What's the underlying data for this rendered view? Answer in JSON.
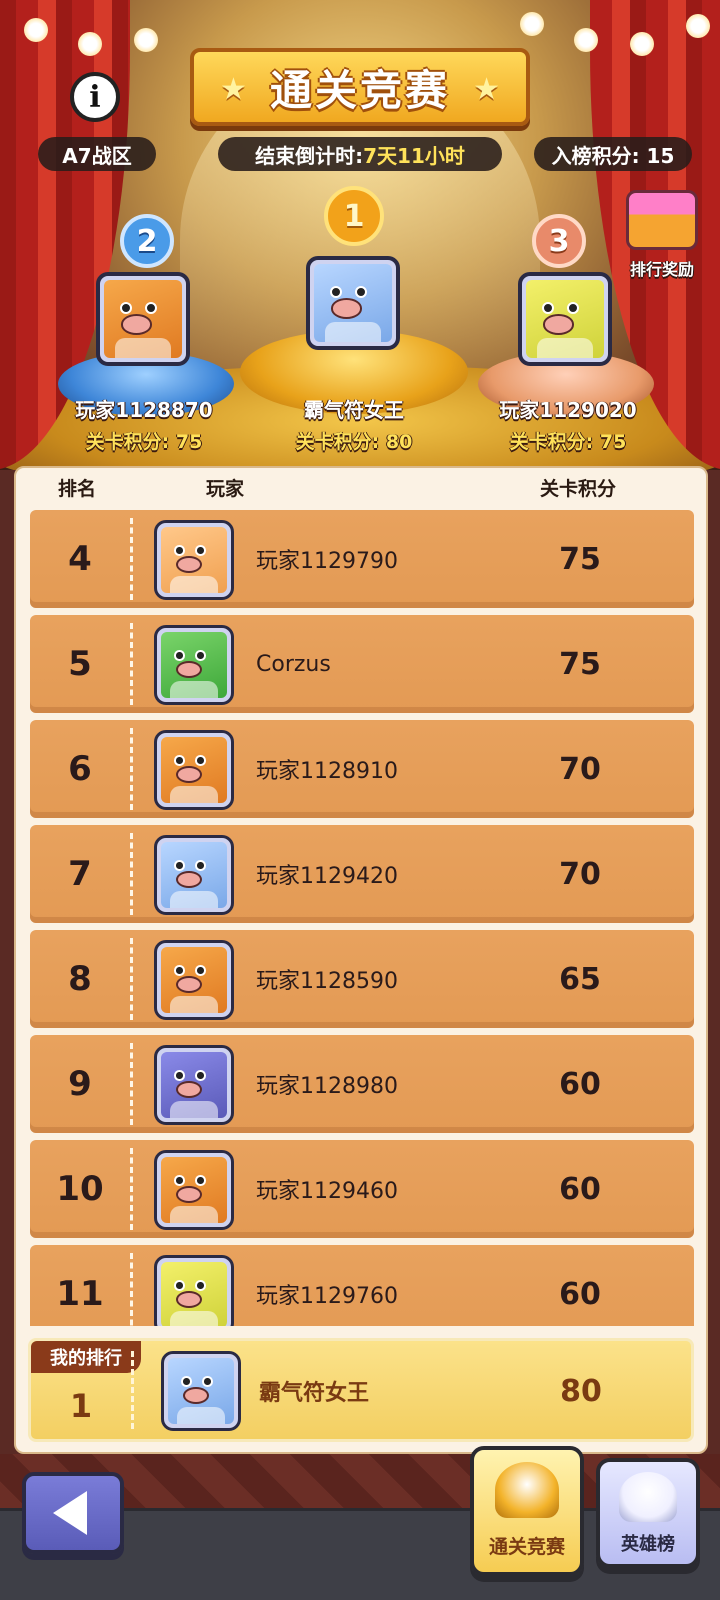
{
  "header": {
    "title": "通关竞赛",
    "zone": "A7战区",
    "countdown_label": "结束倒计时:",
    "countdown_value": "7天11小时",
    "entry_score": "入榜积分: 15",
    "reward_label": "排行奖励"
  },
  "podium": [
    {
      "rank": "1",
      "name": "霸气符女王",
      "score": "关卡积分: 80",
      "avatar": "blue"
    },
    {
      "rank": "2",
      "name": "玩家1128870",
      "score": "关卡积分: 75",
      "avatar": "orange"
    },
    {
      "rank": "3",
      "name": "玩家1129020",
      "score": "关卡积分: 75",
      "avatar": "yellow"
    }
  ],
  "table": {
    "headers": {
      "rank": "排名",
      "player": "玩家",
      "score": "关卡积分"
    },
    "rows": [
      {
        "rank": "4",
        "name": "玩家1129790",
        "score": "75",
        "avatar": "peach"
      },
      {
        "rank": "5",
        "name": "Corzus",
        "score": "75",
        "avatar": "green"
      },
      {
        "rank": "6",
        "name": "玩家1128910",
        "score": "70",
        "avatar": "orange"
      },
      {
        "rank": "7",
        "name": "玩家1129420",
        "score": "70",
        "avatar": "blue"
      },
      {
        "rank": "8",
        "name": "玩家1128590",
        "score": "65",
        "avatar": "orange"
      },
      {
        "rank": "9",
        "name": "玩家1128980",
        "score": "60",
        "avatar": "purple"
      },
      {
        "rank": "10",
        "name": "玩家1129460",
        "score": "60",
        "avatar": "orange"
      },
      {
        "rank": "11",
        "name": "玩家1129760",
        "score": "60",
        "avatar": "yellow"
      }
    ]
  },
  "my_rank": {
    "label": "我的排行",
    "rank": "1",
    "name": "霸气符女王",
    "score": "80",
    "avatar": "blue"
  },
  "tabs": [
    {
      "label": "通关竞赛",
      "active": true,
      "icon": "trophy-icon"
    },
    {
      "label": "英雄榜",
      "active": false,
      "icon": "hero-icon"
    }
  ],
  "icons": {
    "info": "info-icon",
    "back": "back-arrow-icon",
    "reward": "gift-chest-icon"
  }
}
